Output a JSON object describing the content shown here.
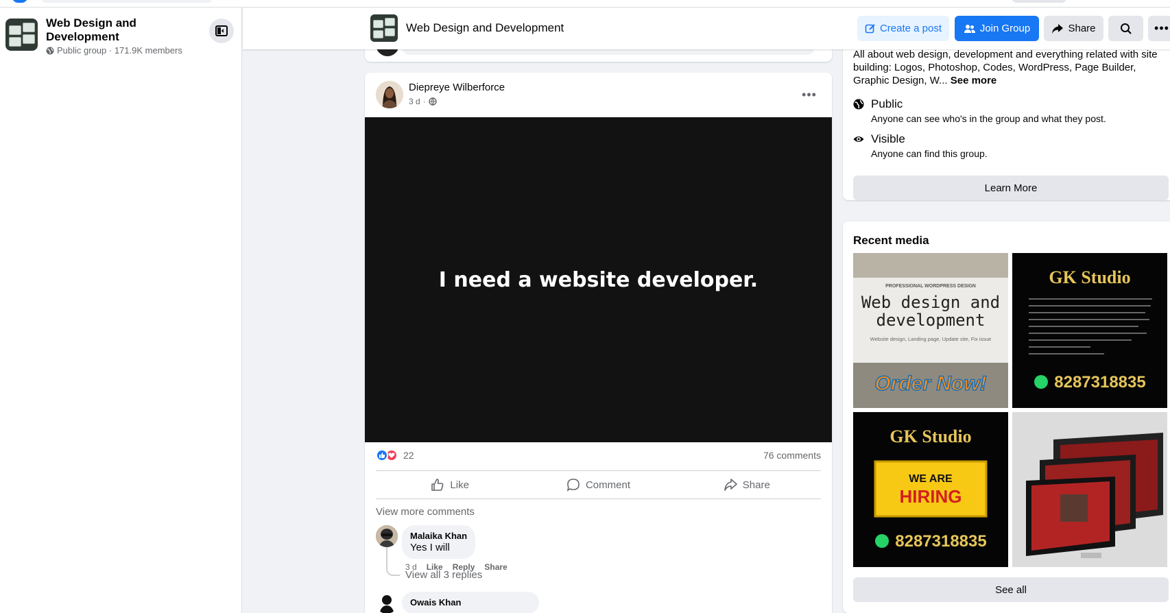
{
  "group": {
    "name": "Web Design and Development",
    "meta": "Public group · 171.9K members"
  },
  "header": {
    "title": "Web Design and Development",
    "create_label": "Create a post",
    "join_label": "Join Group",
    "share_label": "Share"
  },
  "post": {
    "author": "Diepreye Wilberforce",
    "time": "3 d",
    "media_text": "I need a website developer.",
    "reaction_count": "22",
    "comments_count": "76 comments",
    "actions": {
      "like": "Like",
      "comment": "Comment",
      "share": "Share"
    },
    "view_more": "View more comments",
    "comments": [
      {
        "name": "Malaika Khan",
        "text": "Yes I will",
        "time": "3 d",
        "like": "Like",
        "reply": "Reply",
        "share": "Share",
        "view_replies": "View all 3 replies"
      },
      {
        "name": "Owais Khan"
      }
    ]
  },
  "about": {
    "description": "All about web design, development and everything related with site building: Logos, Photoshop, Codes, WordPress, Page Builder, Graphic Design, W...",
    "see_more": "See more",
    "public_title": "Public",
    "public_sub": "Anyone can see who's in the group and what they post.",
    "visible_title": "Visible",
    "visible_sub": "Anyone can find this group.",
    "learn_more": "Learn More"
  },
  "recent_media": {
    "title": "Recent media",
    "see_all": "See all",
    "tiles": [
      {
        "kicker": "PROFESSIONAL WORDPRESS DESIGN",
        "line1": "Web design and",
        "line2": "development",
        "small": "Website design, Landing page, Update site, Fix issue",
        "cta": "Order Now!"
      },
      {
        "title": "GK Studio",
        "phone": "8287318835"
      },
      {
        "title": "GK Studio",
        "banner1": "WE ARE",
        "banner2": "HIRING",
        "phone": "8287318835"
      },
      {}
    ]
  },
  "colors": {
    "brand": "#1877f2",
    "love": "#f33e58",
    "media_bg": "#121212"
  }
}
